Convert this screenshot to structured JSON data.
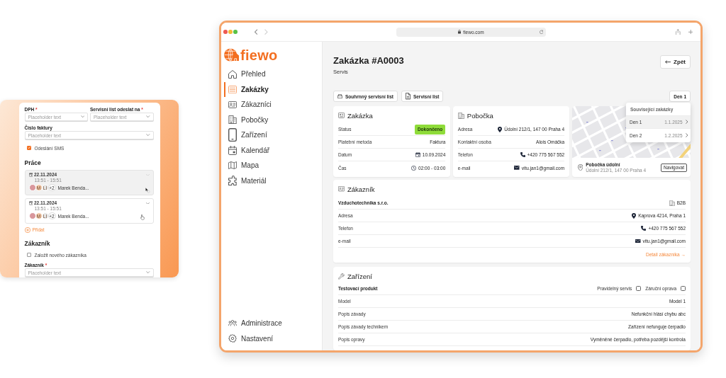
{
  "promo_form": {
    "fields": [
      {
        "label": "DPH",
        "required_mark": "*",
        "placeholder": "Placeholder text"
      },
      {
        "label": "Servisní list odeslat na",
        "required_mark": "*",
        "placeholder": "Placeholder text"
      },
      {
        "label": "Číslo faktury",
        "placeholder": "Placeholder text"
      }
    ],
    "sms_option": {
      "label": "Odeslání SMS",
      "checked": true
    },
    "work_title": "Práce",
    "work_entries": [
      {
        "date": "22.11.2024",
        "time": "13:51 - 15:51",
        "avatars": [
          {
            "kind": "photo",
            "color": "#d9979c"
          },
          {
            "kind": "initials",
            "initials": "M",
            "color": "#f2c7a6"
          },
          {
            "kind": "initials",
            "initials": "LI",
            "color": "#e6e6e6"
          }
        ],
        "more_count": "+2",
        "assignee": "Marek Benda...",
        "highlighted": true,
        "cursor": {
          "kind": "busy"
        }
      },
      {
        "date": "22.11.2024",
        "time": "13:51 - 15:51",
        "avatars": [
          {
            "kind": "photo",
            "color": "#d9979c"
          },
          {
            "kind": "initials",
            "initials": "M",
            "color": "#f2c7a6"
          },
          {
            "kind": "initials",
            "initials": "LI",
            "color": "#e6e6e6"
          }
        ],
        "more_count": "+2",
        "assignee": "Marek Benda...",
        "highlighted": false,
        "cursor": {
          "kind": "hand"
        }
      }
    ],
    "add_label": "Přidat",
    "customer_title": "Zákazník",
    "new_customer_option": {
      "label": "Založit nového zákazníka",
      "checked": false
    },
    "customer_field": {
      "label": "Zákazník",
      "required_mark": "*",
      "placeholder": "Placeholder text"
    }
  },
  "browser": {
    "url": "fiewo.com",
    "back_disabled": false,
    "forward_disabled": true
  },
  "sidebar": {
    "logo": "fiewo",
    "items": [
      {
        "label": "Přehled",
        "selected": false
      },
      {
        "label": "Zakázky",
        "selected": true
      },
      {
        "label": "Zákazníci",
        "selected": false
      },
      {
        "label": "Pobočky",
        "selected": false
      },
      {
        "label": "Zařízení",
        "selected": false
      },
      {
        "label": "Kalendář",
        "selected": false
      },
      {
        "label": "Mapa",
        "selected": false
      },
      {
        "label": "Materiál",
        "selected": false
      }
    ],
    "bottom_items": [
      {
        "label": "Administrace",
        "selected": false
      },
      {
        "label": "Nastavení",
        "selected": false
      }
    ]
  },
  "page": {
    "title": "Zakázka #A0003",
    "subtitle": "Servis",
    "back_button": "Zpět"
  },
  "actions": [
    "Souhrnný servisní list",
    "Servisní list"
  ],
  "day_button": "Den 1",
  "order_card": {
    "title": "Zakázka",
    "rows": [
      {
        "label": "Status",
        "value": "Dokončeno",
        "kind": "badge"
      },
      {
        "label": "Platební metoda",
        "value": "Faktura",
        "kind": "text"
      },
      {
        "label": "Datum",
        "value": "10.09.2024",
        "kind": "date"
      },
      {
        "label": "Čas",
        "value": "02:00 - 03:00",
        "kind": "time"
      }
    ]
  },
  "branch_card": {
    "title": "Pobočka",
    "rows": [
      {
        "label": "Adresa",
        "value": "Údolní 212/1, 147 00 Praha 4",
        "kind": "address"
      },
      {
        "label": "Kontaktní osoba",
        "value": "Alois Omáčka",
        "kind": "text"
      },
      {
        "label": "Telefon",
        "value": "+420 775 567 552",
        "kind": "phone"
      },
      {
        "label": "e-mail",
        "value": "vitu.jan1@gmail.com",
        "kind": "email"
      }
    ]
  },
  "map_card": {
    "place_name": "Pobočka údolní",
    "place_address": "Údolní 212/1, 147 00 Praha 4",
    "navigate_button": "Navigovat"
  },
  "related_menu": {
    "title": "Související zakázky",
    "items": [
      {
        "label": "Den 1",
        "date": "1.1.2025",
        "selected": true
      },
      {
        "label": "Den 2",
        "date": "1.2.2025",
        "selected": false
      }
    ]
  },
  "customer_card": {
    "title": "Zákazník",
    "name": "Vzduchotechnika s.r.o.",
    "type": "B2B",
    "rows": [
      {
        "label": "Adresa",
        "value": "Kaprova 4214, Praha 1",
        "kind": "address"
      },
      {
        "label": "Telefon",
        "value": "+420 775 567 552",
        "kind": "phone"
      },
      {
        "label": "e-mail",
        "value": "vitu.jan1@gmail.com",
        "kind": "email"
      }
    ],
    "detail_link": "Detail zákazníka →"
  },
  "device_card": {
    "title": "Zařízení",
    "product": "Testovací produkt",
    "checks": [
      {
        "label": "Pravidelný servis",
        "checked": false
      },
      {
        "label": "Záruční oprava",
        "checked": false
      }
    ],
    "rows": [
      {
        "label": "Model",
        "value": "Model 1"
      },
      {
        "label": "Popis závady",
        "value": "Nefunkční hlásí chybu abc"
      },
      {
        "label": "Popis závady technikem",
        "value": "Zařízení nefunguje čerpadlo"
      },
      {
        "label": "Popis opravy",
        "value": "Vyměněné čerpadlo, potřeba pozdější kontrola"
      }
    ]
  }
}
